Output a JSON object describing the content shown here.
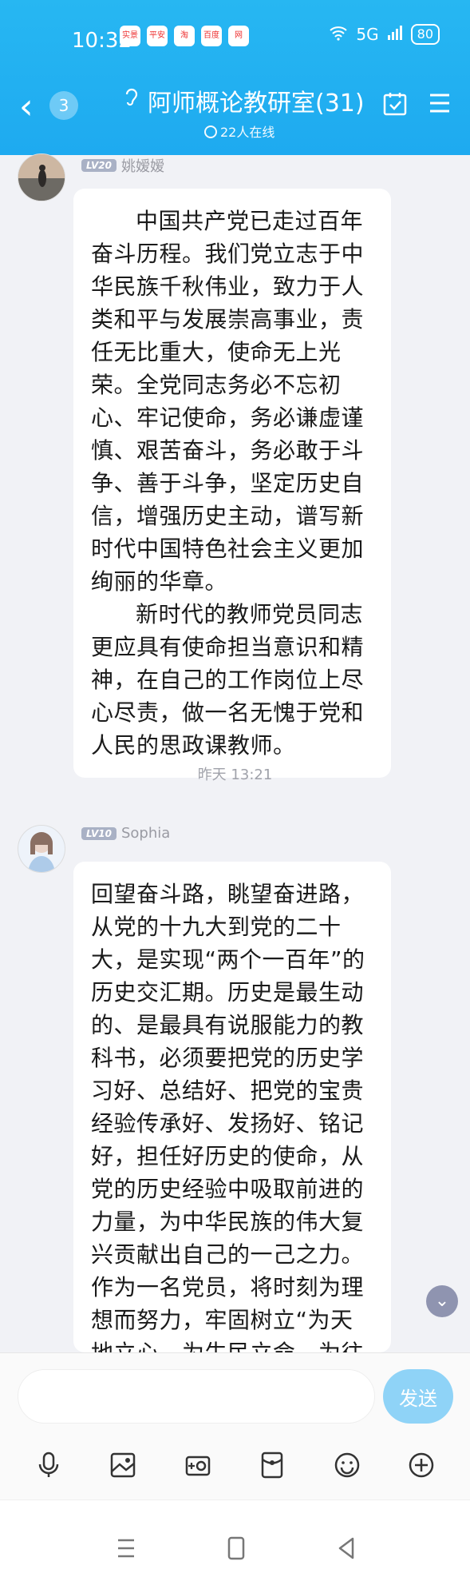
{
  "status_bar": {
    "time": "10:32",
    "apps": [
      "实景",
      "平安",
      "淘",
      "百度",
      "网"
    ],
    "battery": "80",
    "network": "5G"
  },
  "header": {
    "back_count": "3",
    "title": "阿师概论教研室(31)",
    "online": "22人在线"
  },
  "messages": [
    {
      "level": "LV20",
      "name": "姚嫒嫒",
      "paragraphs": [
        "中国共产党已走过百年奋斗历程。我们党立志于中华民族千秋伟业，致力于人类和平与发展崇高事业，责任无比重大，使命无上光荣。全党同志务必不忘初心、牢记使命，务必谦虚谨慎、艰苦奋斗，务必敢于斗争、善于斗争，坚定历史自信，增强历史主动，谱写新时代中国特色社会主义更加绚丽的华章。",
        "新时代的教师党员同志更应具有使命担当意识和精神，在自己的工作岗位上尽心尽责，做一名无愧于党和人民的思政课教师。"
      ]
    },
    {
      "level": "LV10",
      "name": "Sophia",
      "paragraphs": [
        "回望奋斗路，眺望奋进路，从党的十九大到党的二十大，是实现“两个一百年”的历史交汇期。历史是最生动的、是最具有说服能力的教科书，必须要把党的历史学习好、总结好、把党的宝贵经验传承好、发扬好、铭记好，担任好历史的使命，从党的历史经验中吸取前进的力量，为中华民族的伟大复兴贡献出自己的一己之力。作为一名党员，将时刻为理想而努力，牢固树立“为天地立心，为生民立命，为往圣继绝学，为万世开太平”的理想，不断"
      ]
    }
  ],
  "time_separator": "昨天 13:21",
  "input": {
    "placeholder": "",
    "send_label": "发送"
  },
  "toolbar": [
    "mic-icon",
    "image-icon",
    "camera-icon",
    "red-packet-icon",
    "emoji-icon",
    "plus-icon"
  ],
  "colors": {
    "header": "#1eaaf0",
    "send_button": "#8fd3f7",
    "background": "#f1f2f6"
  }
}
